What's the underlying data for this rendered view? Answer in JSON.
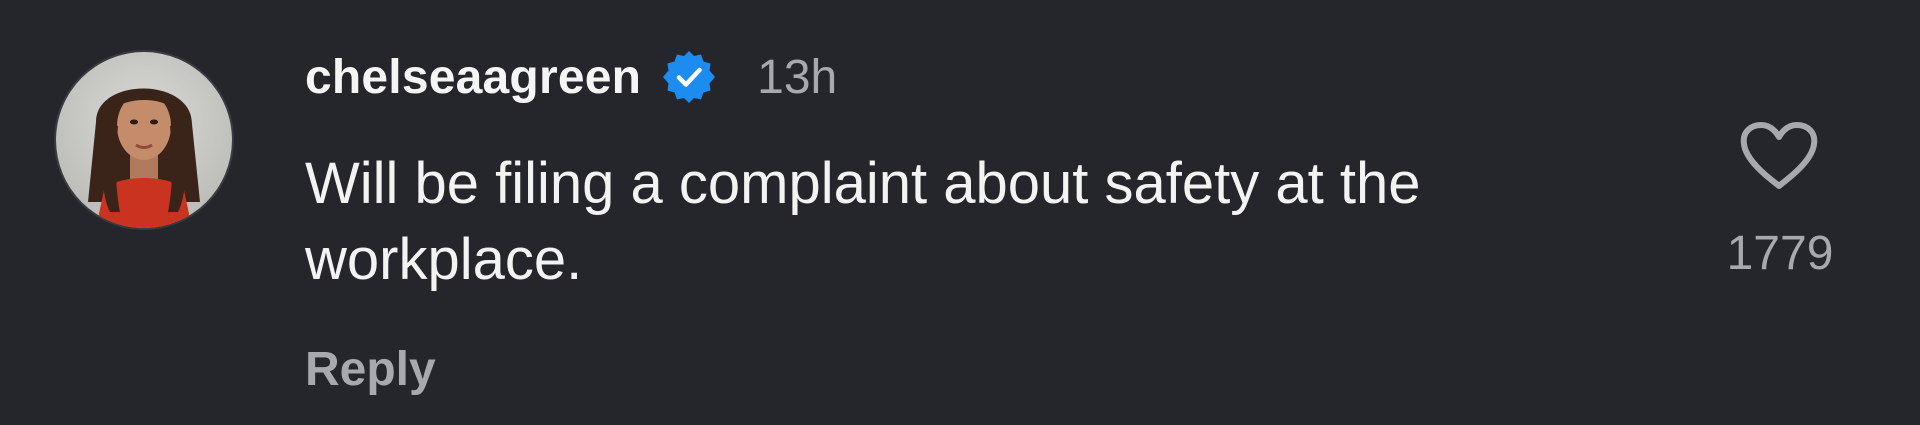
{
  "comment": {
    "username": "chelseaagreen",
    "verified": true,
    "timestamp": "13h",
    "text": "Will be filing a complaint about safety at the workplace.",
    "reply_label": "Reply",
    "likes": "1779",
    "like_icon": "heart-outline-icon",
    "verified_icon": "verified-badge-icon"
  },
  "colors": {
    "background": "#25262b",
    "primary_text": "#f3f3f3",
    "secondary_text": "#a8a9ad",
    "verified_blue": "#1d8cf0"
  }
}
